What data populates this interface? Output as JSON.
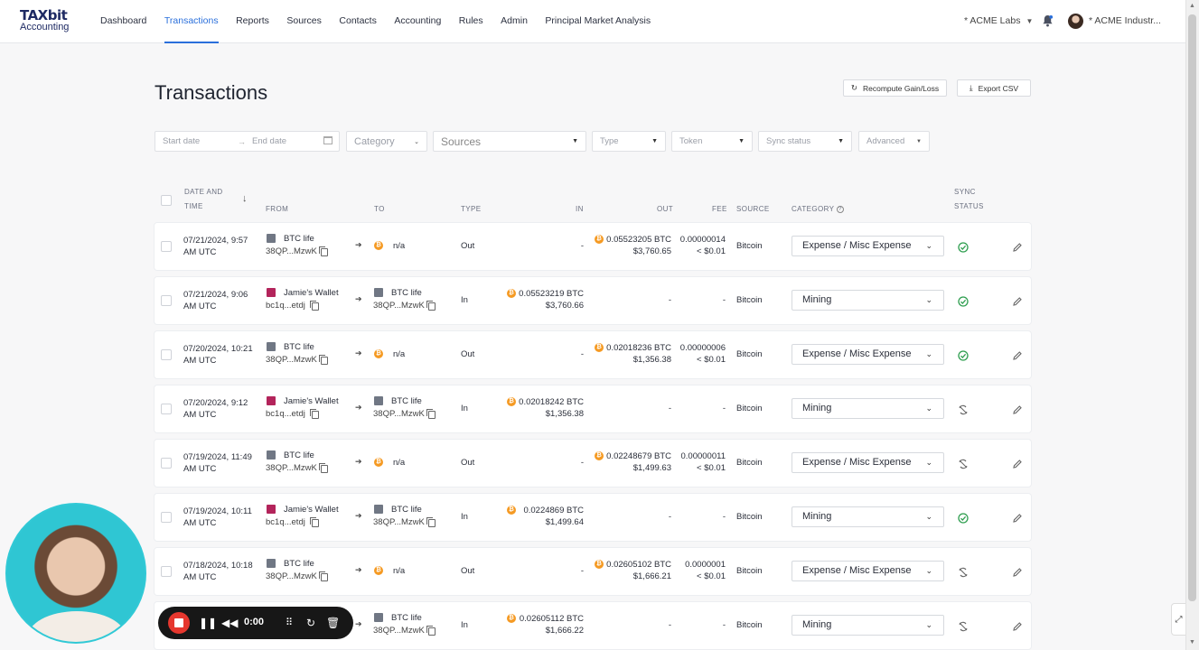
{
  "brand": {
    "line1": "TAXbit",
    "line2": "Accounting"
  },
  "nav": [
    "Dashboard",
    "Transactions",
    "Reports",
    "Sources",
    "Contacts",
    "Accounting",
    "Rules",
    "Admin",
    "Principal Market Analysis"
  ],
  "nav_active": "Transactions",
  "org_name": "* ACME Labs",
  "user_name": "* ACME Industr...",
  "page_title": "Transactions",
  "buttons": {
    "recompute": "Recompute Gain/Loss",
    "export": "Export CSV"
  },
  "filters": {
    "start_date": "Start date",
    "end_date": "End date",
    "category": "Category",
    "sources": "Sources",
    "type": "Type",
    "token": "Token",
    "sync_status": "Sync status",
    "advanced": "Advanced"
  },
  "columns": {
    "date_1": "DATE AND",
    "date_2": "TIME",
    "from": "FROM",
    "to": "TO",
    "type": "TYPE",
    "in": "IN",
    "out": "OUT",
    "fee": "FEE",
    "source": "SOURCE",
    "category": "CATEGORY",
    "sync_1": "SYNC",
    "sync_2": "STATUS"
  },
  "rows": [
    {
      "date": "07/21/2024, 9:57",
      "tz": "AM UTC",
      "from_name": "BTC life",
      "from_addr": "38QP...MzwK",
      "from_icon": "btc",
      "to_name": "n/a",
      "to_addr": "",
      "to_icon": "coin",
      "type": "Out",
      "in_amt": "",
      "in_usd": "-",
      "out_amt": "0.05523205 BTC",
      "out_usd": "$3,760.65",
      "fee_amt": "0.00000014",
      "fee_usd": "< $0.01",
      "source": "Bitcoin",
      "category": "Expense / Misc Expense",
      "sync": "synced"
    },
    {
      "date": "07/21/2024, 9:06",
      "tz": "AM UTC",
      "from_name": "Jamie's Wallet",
      "from_addr": "bc1q...etdj",
      "from_icon": "jam",
      "to_name": "BTC life",
      "to_addr": "38QP...MzwK",
      "to_icon": "btc",
      "type": "In",
      "in_amt": "0.05523219 BTC",
      "in_usd": "$3,760.66",
      "out_amt": "",
      "out_usd": "-",
      "fee_amt": "",
      "fee_usd": "-",
      "source": "Bitcoin",
      "category": "Mining",
      "sync": "synced"
    },
    {
      "date": "07/20/2024, 10:21",
      "tz": "AM UTC",
      "from_name": "BTC life",
      "from_addr": "38QP...MzwK",
      "from_icon": "btc",
      "to_name": "n/a",
      "to_addr": "",
      "to_icon": "coin",
      "type": "Out",
      "in_amt": "",
      "in_usd": "-",
      "out_amt": "0.02018236 BTC",
      "out_usd": "$1,356.38",
      "fee_amt": "0.00000006",
      "fee_usd": "< $0.01",
      "source": "Bitcoin",
      "category": "Expense / Misc Expense",
      "sync": "synced"
    },
    {
      "date": "07/20/2024, 9:12",
      "tz": "AM UTC",
      "from_name": "Jamie's Wallet",
      "from_addr": "bc1q...etdj",
      "from_icon": "jam",
      "to_name": "BTC life",
      "to_addr": "38QP...MzwK",
      "to_icon": "btc",
      "type": "In",
      "in_amt": "0.02018242 BTC",
      "in_usd": "$1,356.38",
      "out_amt": "",
      "out_usd": "-",
      "fee_amt": "",
      "fee_usd": "-",
      "source": "Bitcoin",
      "category": "Mining",
      "sync": "unsynced"
    },
    {
      "date": "07/19/2024, 11:49",
      "tz": "AM UTC",
      "from_name": "BTC life",
      "from_addr": "38QP...MzwK",
      "from_icon": "btc",
      "to_name": "n/a",
      "to_addr": "",
      "to_icon": "coin",
      "type": "Out",
      "in_amt": "",
      "in_usd": "-",
      "out_amt": "0.02248679 BTC",
      "out_usd": "$1,499.63",
      "fee_amt": "0.00000011",
      "fee_usd": "< $0.01",
      "source": "Bitcoin",
      "category": "Expense / Misc Expense",
      "sync": "unsynced"
    },
    {
      "date": "07/19/2024, 10:11",
      "tz": "AM UTC",
      "from_name": "Jamie's Wallet",
      "from_addr": "bc1q...etdj",
      "from_icon": "jam",
      "to_name": "BTC life",
      "to_addr": "38QP...MzwK",
      "to_icon": "btc",
      "type": "In",
      "in_amt": "0.0224869 BTC",
      "in_usd": "$1,499.64",
      "out_amt": "",
      "out_usd": "-",
      "fee_amt": "",
      "fee_usd": "-",
      "source": "Bitcoin",
      "category": "Mining",
      "sync": "synced"
    },
    {
      "date": "07/18/2024, 10:18",
      "tz": "AM UTC",
      "from_name": "BTC life",
      "from_addr": "38QP...MzwK",
      "from_icon": "btc",
      "to_name": "n/a",
      "to_addr": "",
      "to_icon": "coin",
      "type": "Out",
      "in_amt": "",
      "in_usd": "-",
      "out_amt": "0.02605102 BTC",
      "out_usd": "$1,666.21",
      "fee_amt": "0.0000001",
      "fee_usd": "< $0.01",
      "source": "Bitcoin",
      "category": "Expense / Misc Expense",
      "sync": "unsynced"
    },
    {
      "date": "",
      "tz": "",
      "from_name": "",
      "from_addr": "",
      "from_icon": "none",
      "to_name": "BTC life",
      "to_addr": "38QP...MzwK",
      "to_icon": "btc",
      "type": "In",
      "in_amt": "0.02605112 BTC",
      "in_usd": "$1,666.22",
      "out_amt": "",
      "out_usd": "-",
      "fee_amt": "",
      "fee_usd": "-",
      "source": "Bitcoin",
      "category": "Mining",
      "sync": "unsynced"
    }
  ],
  "recorder": {
    "time": "0:00"
  },
  "colors": {
    "accent": "#2a6fdb",
    "synced": "#2e9e4f",
    "bitcoin": "#f59a23"
  }
}
